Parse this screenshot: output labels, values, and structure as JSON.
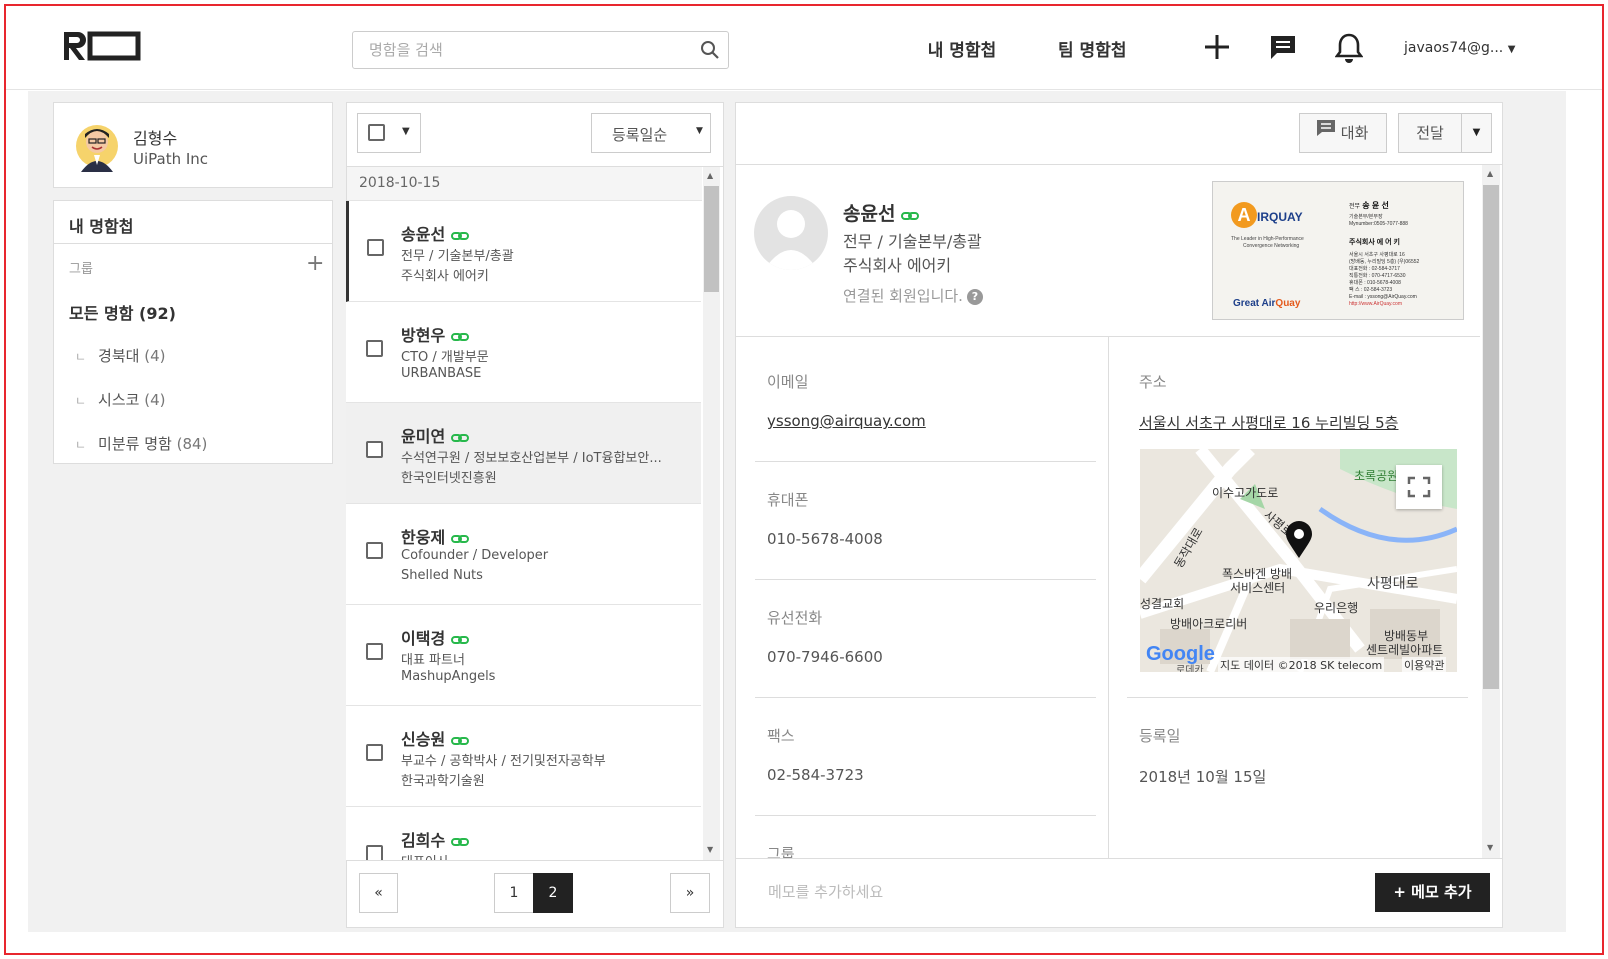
{
  "header": {
    "search_placeholder": "명함을 검색",
    "tabs": [
      {
        "label": "내 명함첩"
      },
      {
        "label": "팀 명함첩"
      }
    ],
    "user": "javaos74@g..."
  },
  "profile": {
    "name": "김형수",
    "company": "UiPath Inc"
  },
  "groups": {
    "title": "내 명함첩",
    "label": "그룹",
    "all": "모든 명함",
    "all_count": "(92)",
    "items": [
      {
        "name": "경북대",
        "count": "(4)"
      },
      {
        "name": "시스코",
        "count": "(4)"
      },
      {
        "name": "미분류 명함",
        "count": "(84)"
      }
    ]
  },
  "list": {
    "sort_label": "등록일순",
    "date": "2018-10-15",
    "cards": [
      {
        "name": "송윤선",
        "title": "전무 / 기술본부/총괄",
        "company": "주식회사 에어키"
      },
      {
        "name": "방현우",
        "title": "CTO / 개발부문",
        "company": "URBANBASE"
      },
      {
        "name": "윤미연",
        "title": "수석연구원 / 정보보호산업본부 / IoT융합보안...",
        "company": "한국인터넷진흥원"
      },
      {
        "name": "한웅제",
        "title": "Cofounder / Developer",
        "company": "Shelled Nuts"
      },
      {
        "name": "이택경",
        "title": "대표 파트너",
        "company": "MashupAngels"
      },
      {
        "name": "신승원",
        "title": "부교수 / 공학박사 / 전기및전자공학부",
        "company": "한국과학기술원"
      },
      {
        "name": "김희수",
        "title": "대표이사",
        "company": ""
      }
    ],
    "pager": {
      "prev": "«",
      "pages": [
        "1",
        "2"
      ],
      "current": "2",
      "next": "»"
    }
  },
  "detail": {
    "chat_label": "대화",
    "forward_label": "전달",
    "name": "송윤선",
    "title": "전무 / 기술본부/총괄",
    "company": "주식회사 에어키",
    "member_status": "연결된 회원입니다.",
    "help": "?",
    "card_image": {
      "logo_a": "A",
      "logo_text": "IRQUAY",
      "tagline1": "The Leader in High-Performance",
      "tagline2": "Convergence Networking",
      "slogan_1": "Great Air",
      "slogan_2": "Quay",
      "right_role": "전무",
      "right_name": "송 윤 선",
      "right_dept": "기술본부/본부장",
      "right_mobile": "Mynumber:0505-7077-888",
      "right_company": "주식회사  에 어 키",
      "right_lines": [
        "서울시 서초구 사평대로 16",
        "(방배동, 누리빌딩 5층) (우)06552",
        "대표전화 : 02-584-3717",
        "직통전화 : 070-4717-6530",
        "휴대폰 : 010-5678-4008",
        "팩 스 : 02-584-3723",
        "E-mail : yssong@AirQuay.com",
        "http://www.AirQuay.com"
      ]
    },
    "fields": {
      "email_label": "이메일",
      "email": "yssong@airquay.com",
      "mobile_label": "휴대폰",
      "mobile": "010-5678-4008",
      "phone_label": "유선전화",
      "phone": "070-7946-6600",
      "fax_label": "팩스",
      "fax": "02-584-3723",
      "group_label": "그룹",
      "address_label": "주소",
      "address": "서울시 서초구 사평대로 16 누리빌딩 5층",
      "regdate_label": "등록일",
      "regdate": "2018년 10월 15일"
    },
    "map": {
      "labels": [
        "초록공원",
        "이수고가도로",
        "사평로",
        "동작대로",
        "폭스바겐 방배",
        "서비스센터",
        "사평대로",
        "성결교회",
        "우리은행",
        "방배아크로리버",
        "방배동부",
        "센트레빌아파트",
        "로데카"
      ],
      "logo": "Google",
      "attribution": "지도 데이터 ©2018 SK telecom",
      "terms": "이용약관"
    },
    "memo_placeholder": "메모를 추가하세요",
    "memo_button": "+ 메모 추가"
  }
}
